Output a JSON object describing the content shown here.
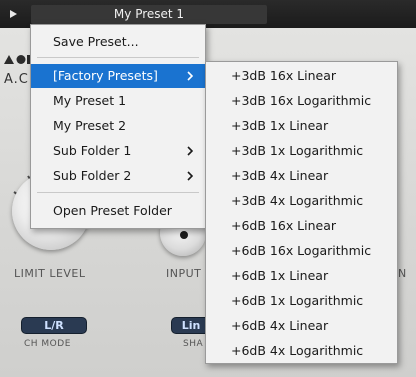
{
  "header": {
    "preset_name": "My Preset 1"
  },
  "plugin": {
    "brand_text": "A.C",
    "knob_labels": {
      "limit_level": "LIMIT LEVEL",
      "input": "INPUT",
      "right_partial": "N"
    },
    "ch_mode": {
      "label": "CH MODE",
      "value": "L/R"
    },
    "shape": {
      "label": "SHA",
      "value": "Lin"
    }
  },
  "preset_menu": {
    "items": [
      {
        "label": "Save Preset..."
      },
      {
        "label": "[Factory Presets]",
        "submenu": true,
        "highlighted": true
      },
      {
        "label": "My Preset 1"
      },
      {
        "label": "My Preset 2"
      },
      {
        "label": "Sub Folder 1",
        "submenu": true
      },
      {
        "label": "Sub Folder 2",
        "submenu": true
      },
      {
        "label": "Open Preset Folder"
      }
    ]
  },
  "factory_submenu": {
    "items": [
      "+3dB 16x Linear",
      "+3dB 16x Logarithmic",
      "+3dB 1x Linear",
      "+3dB 1x Logarithmic",
      "+3dB 4x Linear",
      "+3dB 4x Logarithmic",
      "+6dB 16x Linear",
      "+6dB 16x Logarithmic",
      "+6dB 1x Linear",
      "+6dB 1x Logarithmic",
      "+6dB 4x Linear",
      "+6dB 4x Logarithmic"
    ]
  },
  "colors": {
    "highlight": "#1a73d0",
    "menu_bg": "#f2f2f2",
    "topbar_bg": "#1b1b1b",
    "pill_bg": "#2a3a52"
  }
}
